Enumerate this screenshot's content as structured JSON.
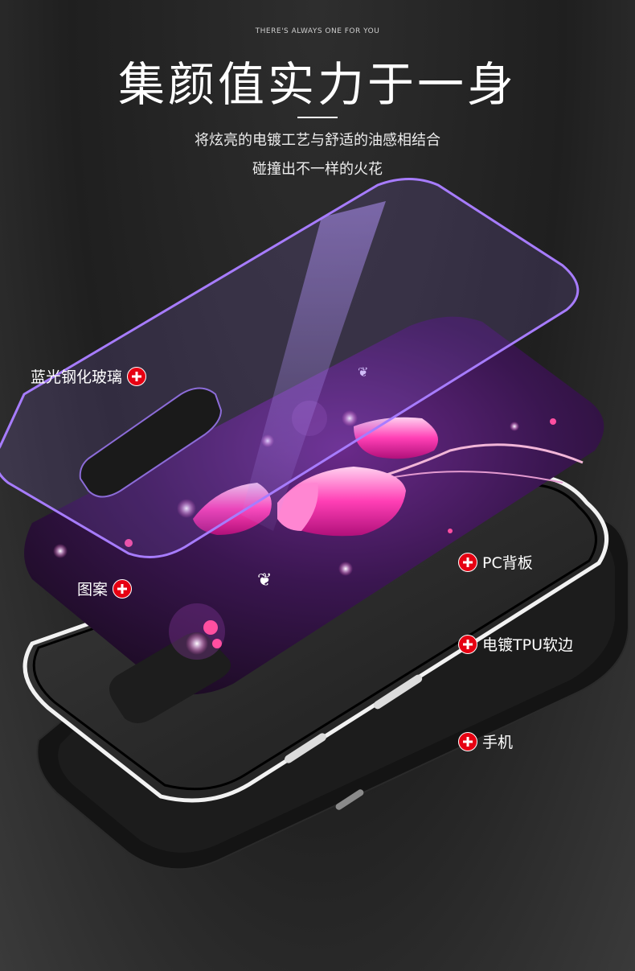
{
  "header": {
    "eyebrow": "THERE'S ALWAYS ONE FOR YOU",
    "headline": "集颜值实力于一身",
    "subline_1": "将炫亮的电镀工艺与舒适的油感相结合",
    "subline_2": "碰撞出不一样的火花"
  },
  "layers": [
    {
      "id": "glass",
      "label": "蓝光钢化玻璃",
      "icon": "plus-icon"
    },
    {
      "id": "pattern",
      "label": "图案",
      "icon": "plus-icon"
    },
    {
      "id": "pc_back",
      "label": "PC背板",
      "icon": "plus-icon"
    },
    {
      "id": "tpu_edge",
      "label": "电镀TPU软边",
      "icon": "plus-icon"
    },
    {
      "id": "phone",
      "label": "手机",
      "icon": "plus-icon"
    }
  ],
  "colors": {
    "accent_red": "#e60012",
    "glass_edge": "#a77cff",
    "flower_pink": "#ff3fb5",
    "pattern_bg": "#3a1650"
  }
}
